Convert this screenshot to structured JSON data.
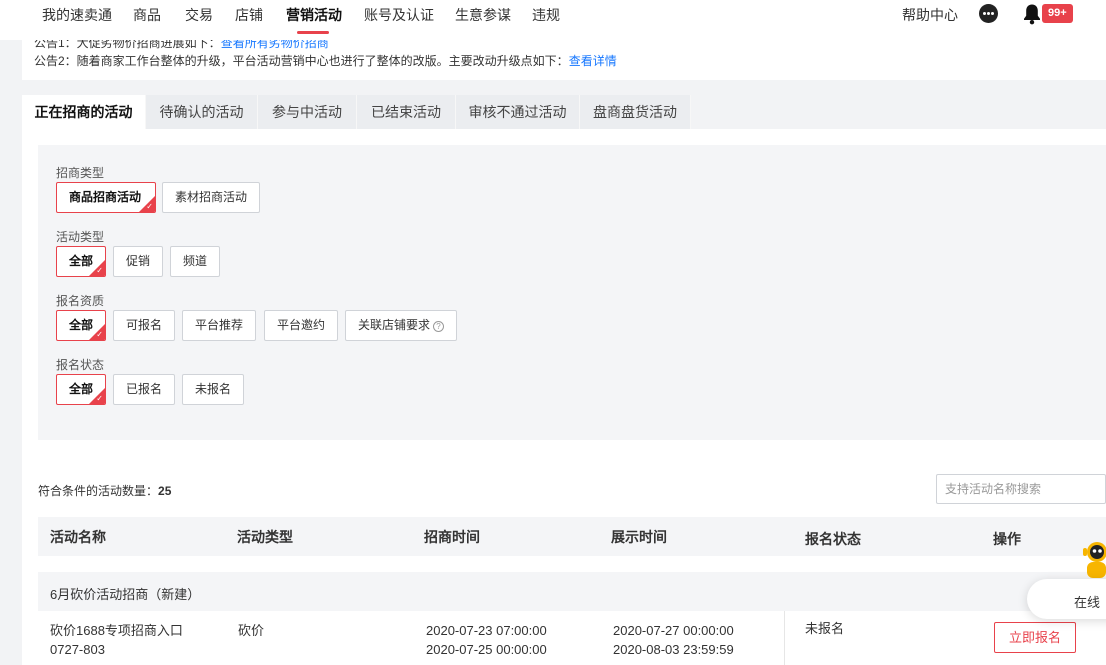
{
  "topnav": {
    "items": [
      "我的速卖通",
      "商品",
      "交易",
      "店铺",
      "营销活动",
      "账号及认证",
      "生意参谋",
      "违规"
    ],
    "active_index": 4,
    "help_center": "帮助中心",
    "notification_count": "99+",
    "icons": {
      "chat": "chat-bubble-icon",
      "bell": "bell-icon"
    }
  },
  "notice": {
    "line1_text": "公告1：大促劣物价招商进展如下：",
    "line1_link": "查看所有劣物价招商",
    "line2_text": "公告2：随着商家工作台整体的升级，平台活动营销中心也进行了整体的改版。主要改动升级点如下：",
    "line2_link": "查看详情"
  },
  "tabs": [
    "正在招商的活动",
    "待确认的活动",
    "参与中活动",
    "已结束活动",
    "审核不通过活动",
    "盘商盘货活动"
  ],
  "active_tab": 0,
  "filters": {
    "merchant_type": {
      "label": "招商类型",
      "options": [
        "商品招商活动",
        "素材招商活动"
      ],
      "selected": 0
    },
    "activity_type": {
      "label": "活动类型",
      "options": [
        "全部",
        "促销",
        "频道"
      ],
      "selected": 0
    },
    "qualification": {
      "label": "报名资质",
      "options": [
        "全部",
        "可报名",
        "平台推荐",
        "平台邀约",
        "关联店铺要求"
      ],
      "selected": 0,
      "help_icon": "question-circle-icon"
    },
    "signup_status": {
      "label": "报名状态",
      "options": [
        "全部",
        "已报名",
        "未报名"
      ],
      "selected": 0
    }
  },
  "results": {
    "count_label": "符合条件的活动数量：",
    "count": "25",
    "search_placeholder": "支持活动名称搜索"
  },
  "table": {
    "columns": [
      "活动名称",
      "活动类型",
      "招商时间",
      "展示时间",
      "报名状态",
      "操作"
    ],
    "groups": [
      {
        "title": "6月砍价活动招商（新建）",
        "rows": [
          {
            "name_line1": "砍价1688专项招商入口",
            "name_line2": "0727-803",
            "type": "砍价",
            "recruit_start": "2020-07-23 07:00:00",
            "recruit_end": "2020-07-25 00:00:00",
            "display_start": "2020-07-27 00:00:00",
            "display_end": "2020-08-03 23:59:59",
            "status": "未报名",
            "action": "立即报名"
          }
        ]
      }
    ]
  },
  "online_service": {
    "label": "在线",
    "icon": "robot-mascot-icon"
  },
  "colors": {
    "accent": "#e8424b",
    "link": "#1677ff",
    "panel": "#f4f5f7"
  }
}
